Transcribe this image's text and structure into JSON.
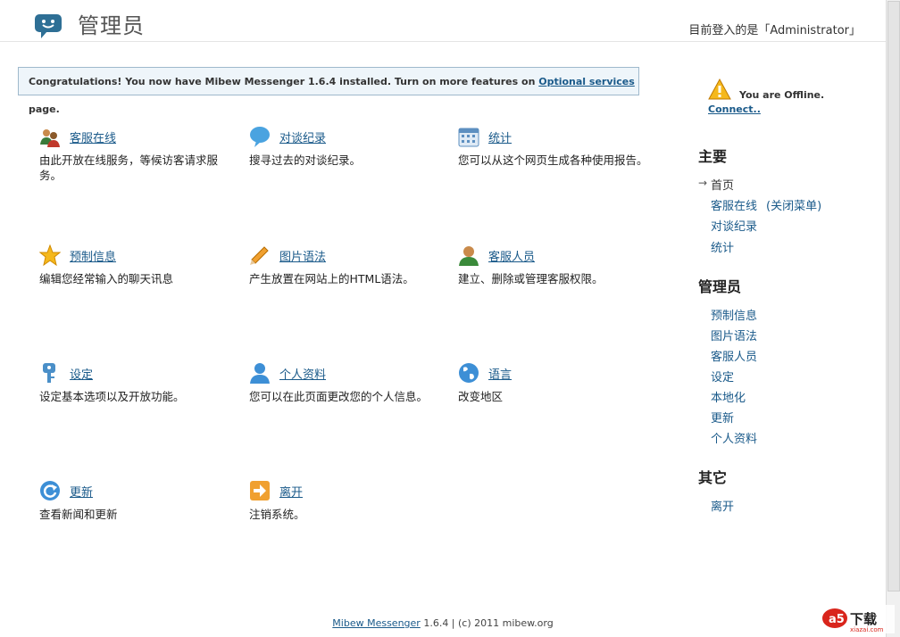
{
  "header": {
    "title": "管理员",
    "user_info": "目前登入的是「Administrator」"
  },
  "notice": {
    "text": "Congratulations! You now have Mibew Messenger 1.6.4 installed. Turn on more features on ",
    "link": "Optional services",
    "suffix": " page."
  },
  "items": [
    {
      "icon": "operators-online-icon",
      "title": "客服在线",
      "desc": "由此开放在线服务，等候访客请求服务。"
    },
    {
      "icon": "chat-history-icon",
      "title": "对谈纪录",
      "desc": "搜寻过去的对谈纪录。"
    },
    {
      "icon": "statistics-calendar-icon",
      "title": "统计",
      "desc": "您可以从这个网页生成各种使用报告。"
    },
    {
      "icon": "star-icon",
      "title": "预制信息",
      "desc": "编辑您经常输入的聊天讯息"
    },
    {
      "icon": "pencil-icon",
      "title": "图片语法",
      "desc": "产生放置在网站上的HTML语法。"
    },
    {
      "icon": "operator-person-icon",
      "title": "客服人员",
      "desc": "建立、删除或管理客服权限。"
    },
    {
      "icon": "settings-key-icon",
      "title": "设定",
      "desc": "设定基本选项以及开放功能。"
    },
    {
      "icon": "profile-person-icon",
      "title": "个人资料",
      "desc": "您可以在此页面更改您的个人信息。"
    },
    {
      "icon": "globe-icon",
      "title": "语言",
      "desc": "改变地区"
    },
    {
      "icon": "update-refresh-icon",
      "title": "更新",
      "desc": "查看新闻和更新"
    },
    {
      "icon": "logout-arrow-icon",
      "title": "离开",
      "desc": "注销系统。"
    }
  ],
  "status": {
    "text": "You are Offline.",
    "connect": "Connect.."
  },
  "sidebar": {
    "main_heading": "主要",
    "main_items": [
      "首页",
      "客服在线",
      "对谈纪录",
      "统计"
    ],
    "close_menu": "(关闭菜单)",
    "admin_heading": "管理员",
    "admin_items": [
      "预制信息",
      "图片语法",
      "客服人员",
      "设定",
      "本地化",
      "更新",
      "个人资料"
    ],
    "other_heading": "其它",
    "other_items": [
      "离开"
    ]
  },
  "footer": {
    "link": "Mibew Messenger",
    "text": " 1.6.4 | (c) 2011 mibew.org"
  },
  "watermark": {
    "text": "下载",
    "sub": "xiazai.com"
  },
  "colors": {
    "link": "#1a5a8a",
    "notice_bg": "#eef5fa",
    "notice_border": "#9fb9cc"
  }
}
